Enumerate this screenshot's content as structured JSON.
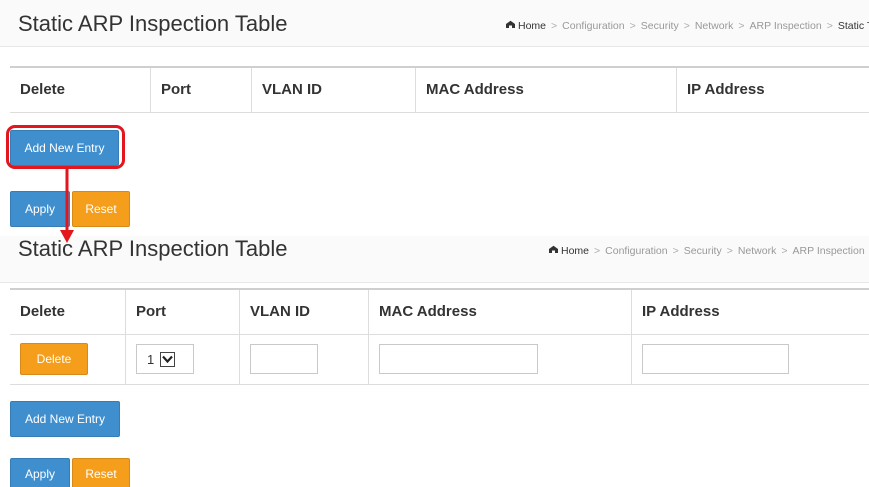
{
  "title": "Static ARP Inspection Table",
  "breadcrumb": {
    "home": "Home",
    "items": [
      "Configuration",
      "Security",
      "Network",
      "ARP Inspection"
    ],
    "current": "Static Table"
  },
  "table": {
    "headers": [
      "Delete",
      "Port",
      "VLAN ID",
      "MAC Address",
      "IP Address"
    ]
  },
  "row": {
    "delete_label": "Delete",
    "port_value": "1"
  },
  "buttons": {
    "add_new_entry": "Add New Entry",
    "apply": "Apply",
    "reset": "Reset"
  },
  "colors": {
    "blue_button": "#3f8fcf",
    "orange_button": "#f59e1c",
    "highlight": "#e2161c"
  }
}
